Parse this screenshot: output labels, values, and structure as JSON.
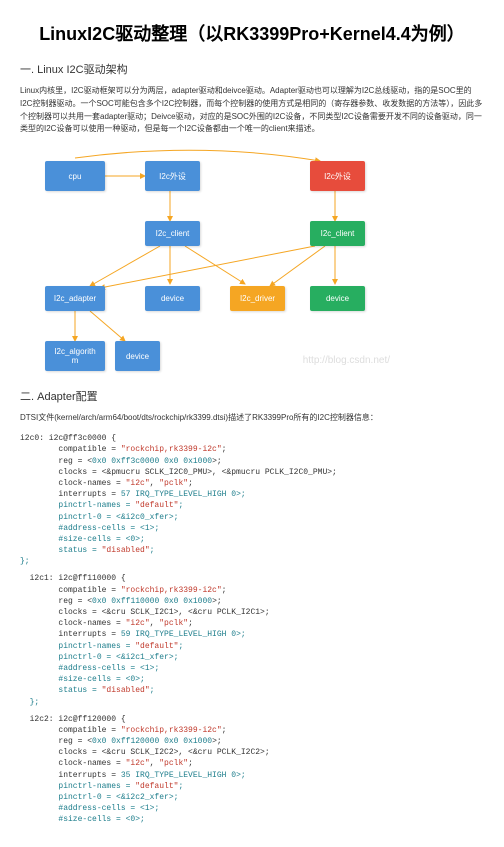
{
  "title": "LinuxI2C驱动整理（以RK3399Pro+Kernel4.4为例）",
  "section1": {
    "heading": "一. Linux I2C驱动架构",
    "para": "Linux内核里，I2C驱动框架可以分为两层，adapter驱动和deivce驱动。Adapter驱动也可以理解为I2C总线驱动，指的是SOC里的I2C控制器驱动。一个SOC可能包含多个I2C控制器，而每个控制器的使用方式是相同的（寄存器参数、收发数据的方法等），因此多个控制器可以共用一套adapter驱动；Deivce驱动，对应的是SOC外围的I2C设备，不同类型I2C设备需要开发不同的设备驱动，同一类型的I2C设备可以使用一种驱动，但是每一个I2C设备都由一个唯一的client来描述。"
  },
  "diagram": {
    "cpu": "cpu",
    "i2c_periph1": "I2c外设",
    "i2c_periph2": "I2c外设",
    "i2c_client1": "I2c_client",
    "i2c_client2": "I2c_client",
    "i2c_adapter": "I2c_adapter",
    "device1": "device",
    "i2c_driver": "I2c_driver",
    "device2": "device",
    "i2c_algorithm": "I2c_algorith\nm",
    "device3": "device",
    "watermark": "http://blog.csdn.net/"
  },
  "section2": {
    "heading": "二. Adapter配置",
    "desc": "DTSI文件(kernel/arch/arm64/boot/dts/rockchip/rk3399.dtsi)描述了RK3399Pro所有的I2C控制器信息："
  },
  "code_blocks": [
    "i2c0: i2c@ff3c0000 {\n        compatible = \"rockchip,rk3399-i2c\";\n        reg = <0x0 0xff3c0000 0x0 0x1000>;\n        clocks = <&pmucru SCLK_I2C0_PMU>, <&pmucru PCLK_I2C0_PMU>;\n        clock-names = \"i2c\", \"pclk\";\n        interrupts = <GIC_SPI 57 IRQ_TYPE_LEVEL_HIGH 0>;\n        pinctrl-names = \"default\";\n        pinctrl-0 = <&i2c0_xfer>;\n        #address-cells = <1>;\n        #size-cells = <0>;\n        status = \"disabled\";\n};",
    "  i2c1: i2c@ff110000 {\n        compatible = \"rockchip,rk3399-i2c\";\n        reg = <0x0 0xff110000 0x0 0x1000>;\n        clocks = <&cru SCLK_I2C1>, <&cru PCLK_I2C1>;\n        clock-names = \"i2c\", \"pclk\";\n        interrupts = <GIC_SPI 59 IRQ_TYPE_LEVEL_HIGH 0>;\n        pinctrl-names = \"default\";\n        pinctrl-0 = <&i2c1_xfer>;\n        #address-cells = <1>;\n        #size-cells = <0>;\n        status = \"disabled\";\n  };",
    "  i2c2: i2c@ff120000 {\n        compatible = \"rockchip,rk3399-i2c\";\n        reg = <0x0 0xff120000 0x0 0x1000>;\n        clocks = <&cru SCLK_I2C2>, <&cru PCLK_I2C2>;\n        clock-names = \"i2c\", \"pclk\";\n        interrupts = <GIC_SPI 35 IRQ_TYPE_LEVEL_HIGH 0>;\n        pinctrl-names = \"default\";\n        pinctrl-0 = <&i2c2_xfer>;\n        #address-cells = <1>;\n        #size-cells = <0>;"
  ]
}
